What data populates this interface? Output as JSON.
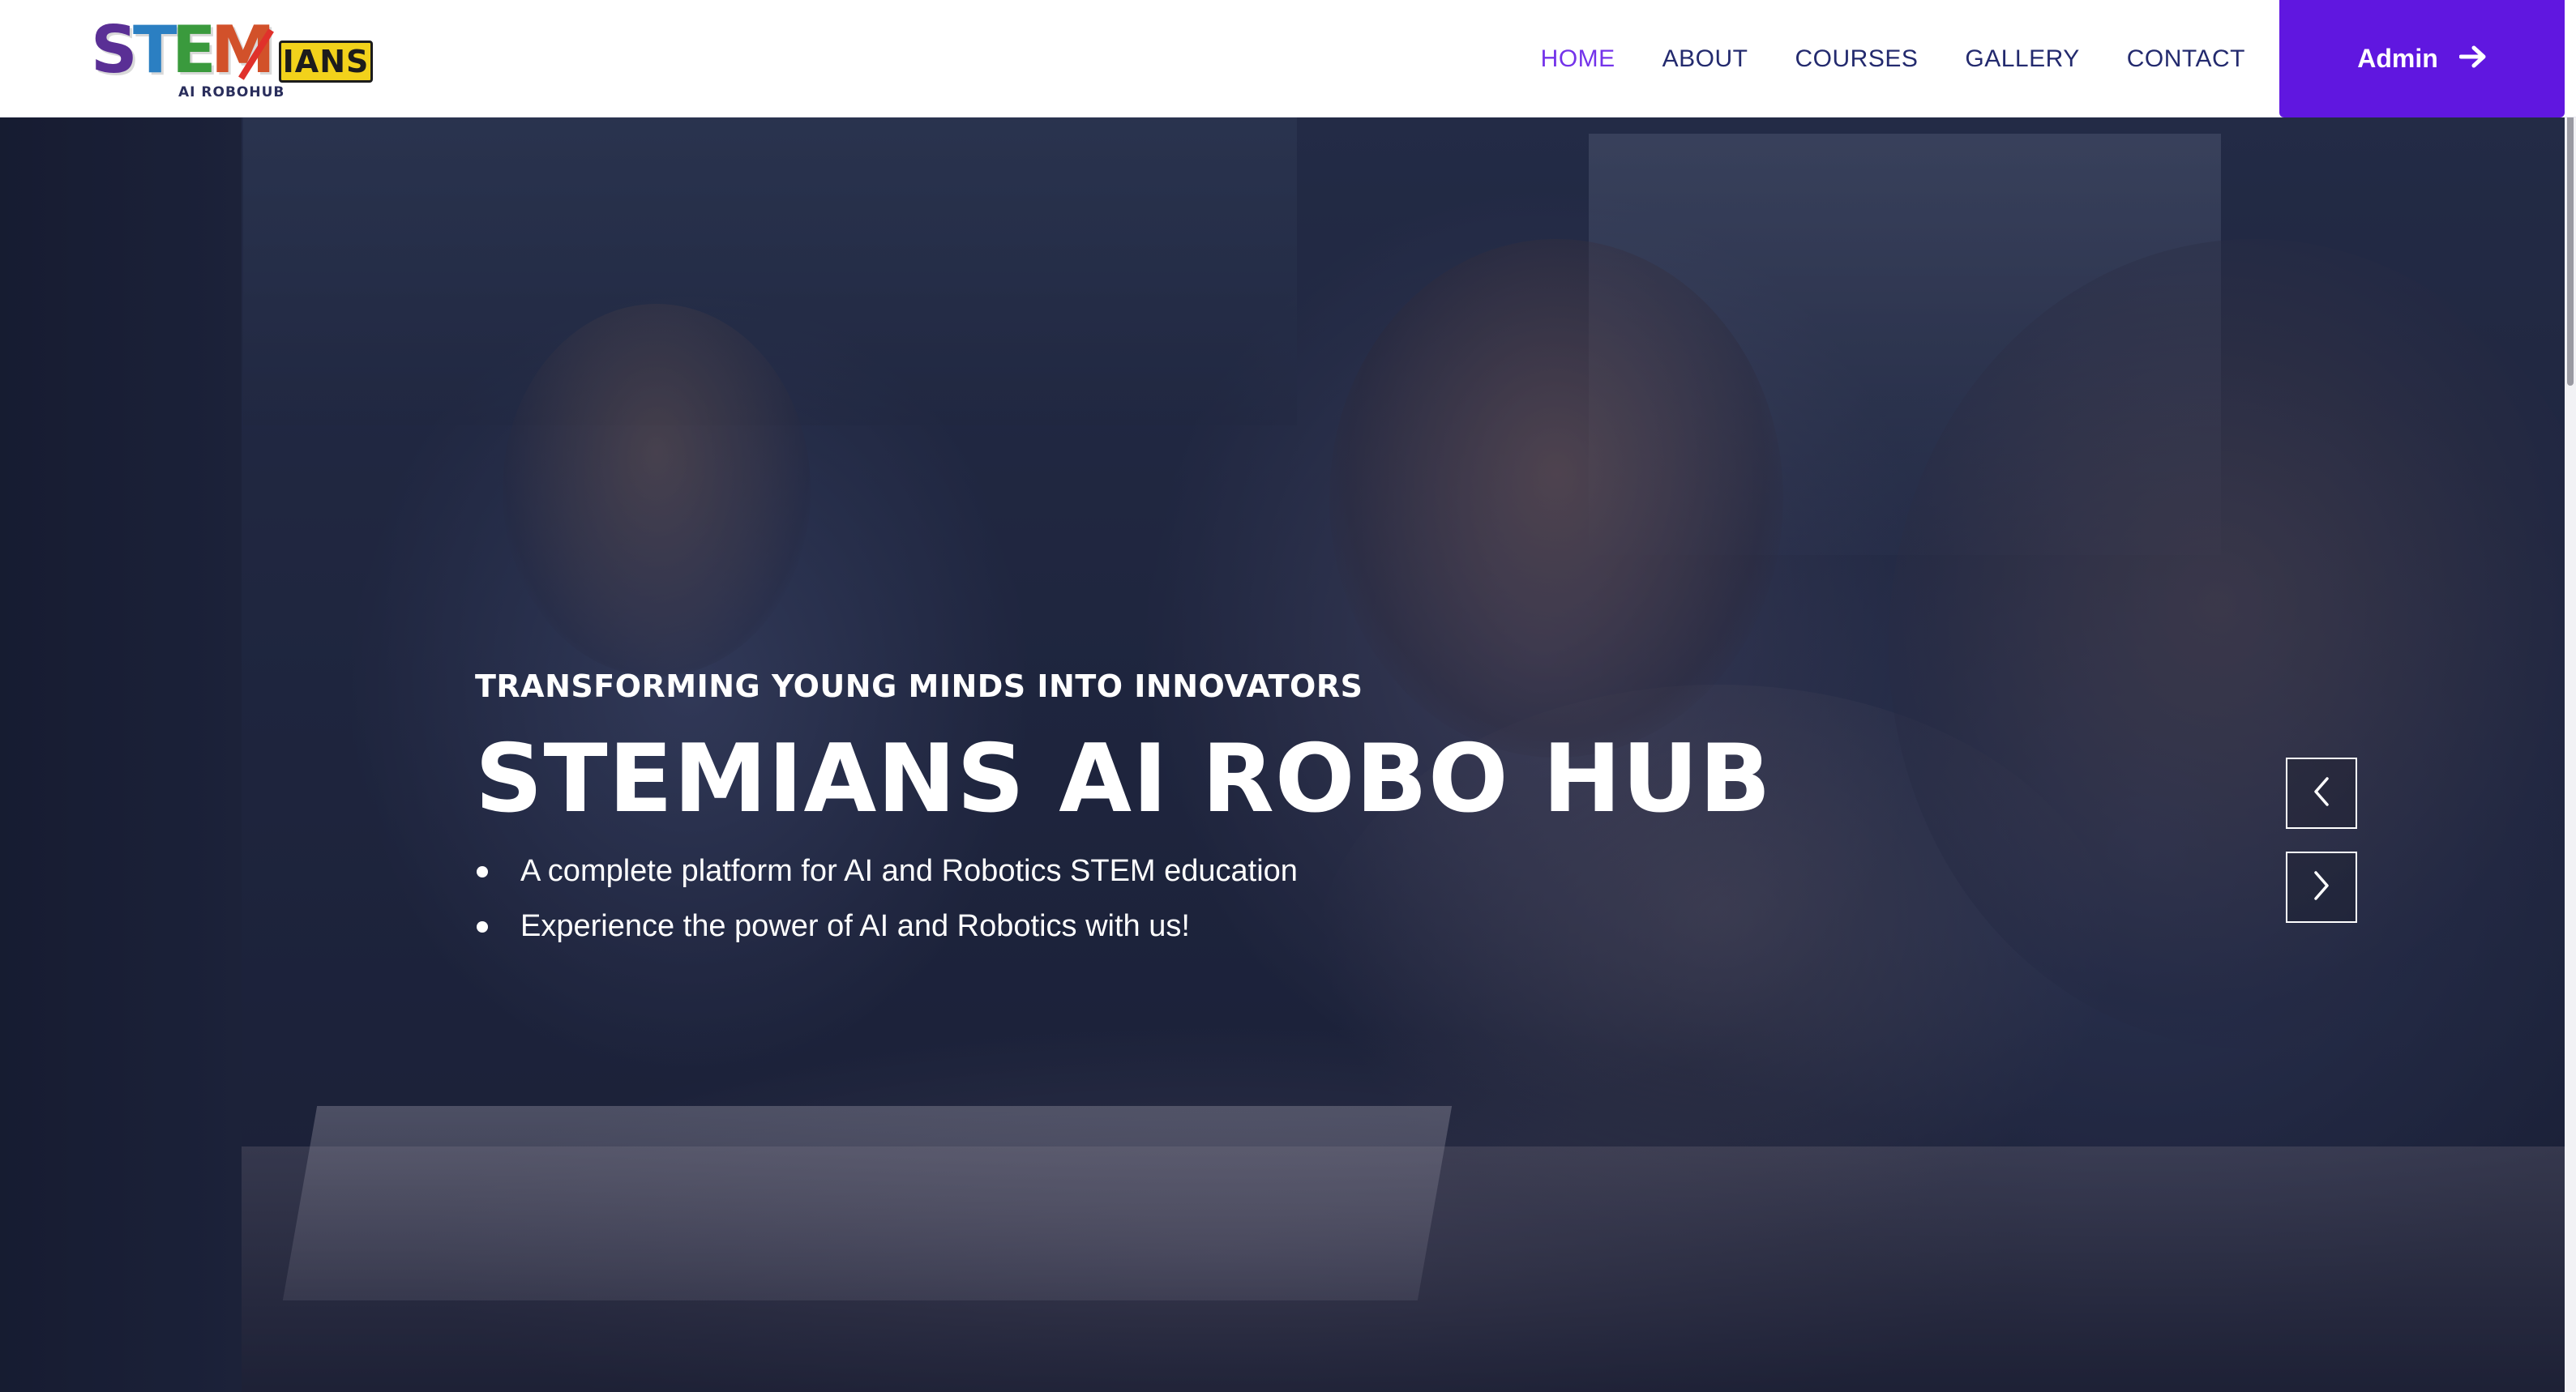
{
  "brand": {
    "logo_letters": [
      "S",
      "T",
      "E",
      "M"
    ],
    "logo_badge": "IANS",
    "logo_subtitle": "AI ROBOHUB",
    "colors": {
      "primary": "#6017e0",
      "nav_text": "#232a6e",
      "nav_active": "#7433ea"
    }
  },
  "nav": {
    "items": [
      {
        "label": "HOME",
        "active": true
      },
      {
        "label": "ABOUT",
        "active": false
      },
      {
        "label": "COURSES",
        "active": false
      },
      {
        "label": "GALLERY",
        "active": false
      },
      {
        "label": "CONTACT",
        "active": false
      }
    ],
    "admin_label": "Admin",
    "admin_icon": "arrow-right-icon"
  },
  "hero": {
    "eyebrow": "TRANSFORMING YOUNG MINDS INTO INNOVATORS",
    "title": "STEMIANS AI ROBO HUB",
    "bullets": [
      "A complete platform for AI and Robotics STEM education",
      "Experience the power of AI and Robotics with us!"
    ],
    "carousel": {
      "prev_icon": "chevron-left-icon",
      "next_icon": "chevron-right-icon"
    }
  },
  "dev_toggle": {
    "icon": "code-toggle-icon",
    "text": ">.<"
  }
}
